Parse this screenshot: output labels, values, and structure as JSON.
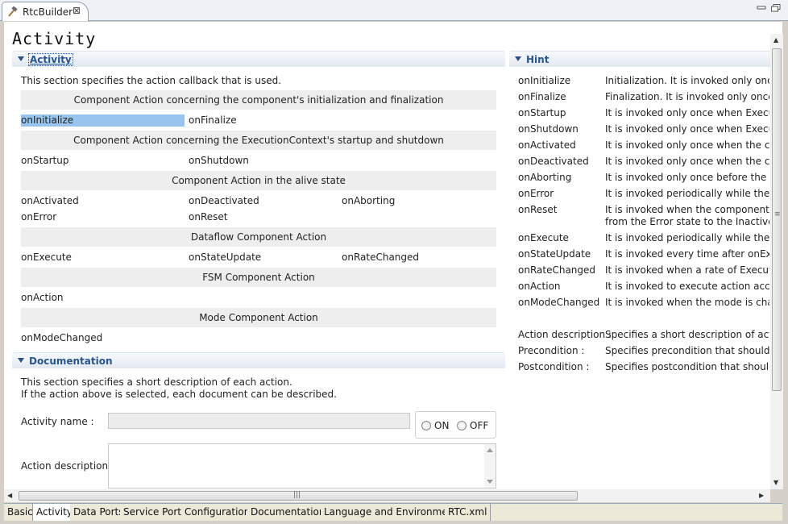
{
  "window": {
    "tab_title": "RtcBuilder"
  },
  "page_title": "Activity",
  "activity_section": {
    "title": "Activity",
    "description": "This section specifies the action callback that is used.",
    "groups": [
      "Component Action concerning the component's initialization and finalization",
      "Component Action concerning the ExecutionContext's startup and shutdown",
      "Component Action in the alive state",
      "Dataflow Component Action",
      "FSM Component Action",
      "Mode Component Action"
    ],
    "actions": {
      "onInitialize": "onInitialize",
      "onFinalize": "onFinalize",
      "onStartup": "onStartup",
      "onShutdown": "onShutdown",
      "onActivated": "onActivated",
      "onDeactivated": "onDeactivated",
      "onAborting": "onAborting",
      "onError": "onError",
      "onReset": "onReset",
      "onExecute": "onExecute",
      "onStateUpdate": "onStateUpdate",
      "onRateChanged": "onRateChanged",
      "onAction": "onAction",
      "onModeChanged": "onModeChanged"
    },
    "selected": "onInitialize"
  },
  "documentation_section": {
    "title": "Documentation",
    "description_line1": "This section specifies a short description of each action.",
    "description_line2": "If the action above is selected, each document can be described.",
    "activity_name_label": "Activity name :",
    "activity_name_value": "",
    "on_label": "ON",
    "off_label": "OFF",
    "action_description_label": "Action description :"
  },
  "hint_section": {
    "title": "Hint",
    "rows": [
      {
        "name": "onInitialize",
        "text": "Initialization. It is invoked only once wh"
      },
      {
        "name": "onFinalize",
        "text": "Finalization. It is invoked only once wh"
      },
      {
        "name": "onStartup",
        "text": "It is invoked only once when Execution"
      },
      {
        "name": "onShutdown",
        "text": "It is invoked only once when Execution"
      },
      {
        "name": "onActivated",
        "text": "It is invoked only once when the comp"
      },
      {
        "name": "onDeactivated",
        "text": "It is invoked only once when the comp"
      },
      {
        "name": "onAborting",
        "text": "It is invoked only once before the comp"
      },
      {
        "name": "onError",
        "text": "It is invoked periodically while the com"
      },
      {
        "name": "onReset",
        "text": "It is invoked when the component reco",
        "text2": "from the Error state to the Inactive stat"
      },
      {
        "name": "onExecute",
        "text": "It is invoked periodically while the com"
      },
      {
        "name": "onStateUpdate",
        "text": "It is invoked every time after onExecute"
      },
      {
        "name": "onRateChanged",
        "text": "It is invoked when a rate of ExecutionC"
      },
      {
        "name": "onAction",
        "text": "It is invoked to execute action accordin"
      },
      {
        "name": "onModeChanged",
        "text": "It is invoked when the mode is changed"
      }
    ],
    "extra": [
      {
        "name": "Action description :",
        "text": "Specifies a short description of activity."
      },
      {
        "name": "Precondition :",
        "text": "Specifies precondition that should be s"
      },
      {
        "name": "Postcondition :",
        "text": "Specifies postcondition that should be"
      }
    ]
  },
  "page_tabs": [
    "Basic",
    "Activity",
    "Data Ports",
    "Service Ports",
    "Configuration",
    "Documentation",
    "Language and Environment",
    "RTC.xml"
  ],
  "active_page_tab": "Activity"
}
